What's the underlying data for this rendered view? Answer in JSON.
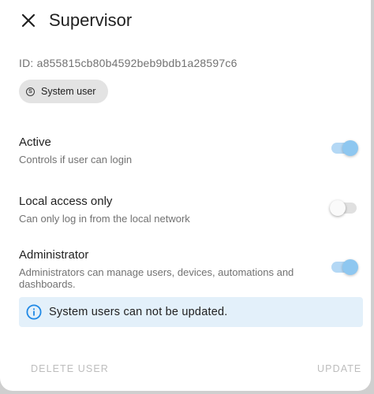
{
  "dialog": {
    "title": "Supervisor",
    "close_icon": "close-icon"
  },
  "user": {
    "id_text": "ID: a855815cb80b4592beb9bdb1a28597c6",
    "chip_label": "System user",
    "chip_icon": "system-user-icon"
  },
  "settings": [
    {
      "title": "Active",
      "description": "Controls if user can login",
      "enabled": true
    },
    {
      "title": "Local access only",
      "description": "Can only log in from the local network",
      "enabled": false
    },
    {
      "title": "Administrator",
      "description": "Administrators can manage users, devices, automations and dashboards.",
      "enabled": true
    }
  ],
  "alert": {
    "icon": "info-icon",
    "text": "System users can not be updated.",
    "color": "#1e88e5"
  },
  "footer": {
    "delete_label": "DELETE USER",
    "update_label": "UPDATE"
  },
  "colors": {
    "accent": "#8ec7f0",
    "alert_bg": "#e3f0fa",
    "disabled_text": "#bdbdbd"
  }
}
